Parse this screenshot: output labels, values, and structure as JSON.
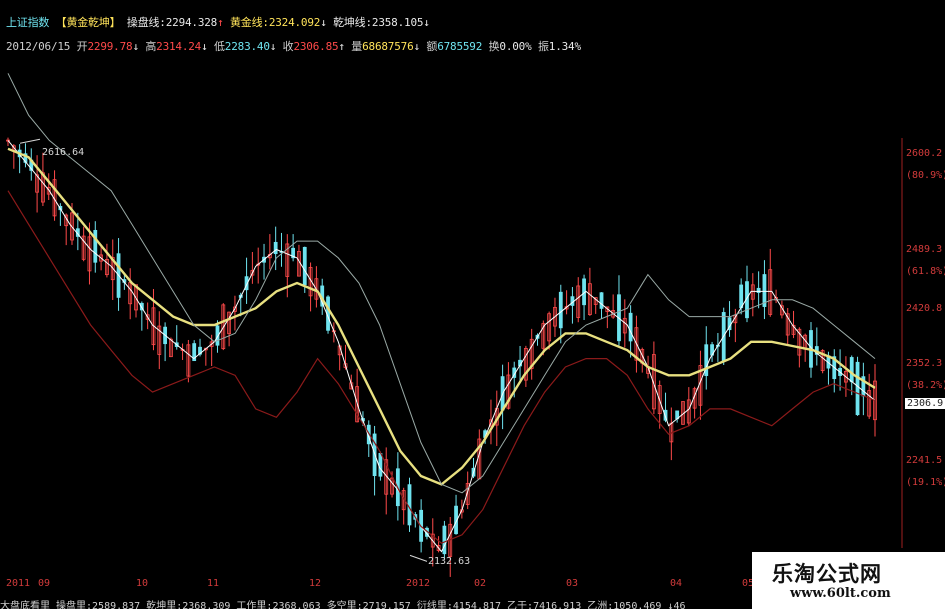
{
  "header": {
    "line1": {
      "index_name": "上证指数",
      "indicator": "【黄金乾坤】",
      "caopan_label": "操盘线:",
      "caopan_value": "2294.328",
      "caopan_arrow": "↑",
      "huangjin_label": "黄金线:",
      "huangjin_value": "2324.092",
      "huangjin_arrow": "↓",
      "qiankun_label": "乾坤线:",
      "qiankun_value": "2358.105",
      "qiankun_arrow": "↓"
    },
    "line2": {
      "date": "2012/06/15",
      "open_label": "开",
      "open_value": "2299.78",
      "open_arrow": "↓",
      "high_label": "高",
      "high_value": "2314.24",
      "high_arrow": "↓",
      "low_label": "低",
      "low_value": "2283.40",
      "low_arrow": "↓",
      "close_label": "收",
      "close_value": "2306.85",
      "close_arrow": "↑",
      "volume_label": "量",
      "volume_value": "68687576",
      "volume_arrow": "↓",
      "amount_label": "额",
      "amount_value": "6785592",
      "turnover_label": "换",
      "turnover_value": "0.00%",
      "amplitude_label": "振",
      "amplitude_value": "1.34%"
    }
  },
  "y_axis": [
    {
      "price": "2600.2",
      "pct": "(80.9%)"
    },
    {
      "price": "2489.3",
      "pct": "(61.8%)"
    },
    {
      "price": "2420.8",
      "pct": ""
    },
    {
      "price": "2352.3",
      "pct": "(38.2%)"
    },
    {
      "price": "2241.5",
      "pct": "(19.1%)"
    }
  ],
  "current_price": "2306.9",
  "annotations": {
    "high_mark": "2616.64",
    "low_mark": "2132.63"
  },
  "x_axis": [
    "2011",
    "09",
    "10",
    "11",
    "12",
    "2012",
    "02",
    "03",
    "04",
    "05"
  ],
  "bottom_bar": "大盘底看里  操盘里:2589.837  乾坤里:2368.309  工作里:2368.063  多空里:2719.157  衍线里:4154.817  乙于:7416.913  乙洲:1050.469  ↓46",
  "watermark": {
    "title": "乐淘公式网",
    "url": "www.60lt.com"
  },
  "colors": {
    "up": "#ff4a4a",
    "down": "#6fe3ef",
    "huangjin": "#e8e080",
    "caopan": "#ffffff",
    "qiankun": "#9aaaa6",
    "lower": "#8b1a1a"
  },
  "chart_data": {
    "type": "line",
    "title": "",
    "xlabel": "",
    "ylabel": "",
    "ylim": [
      2100,
      2650
    ],
    "x_ticks": [
      "2011",
      "09",
      "10",
      "11",
      "12",
      "2012",
      "02",
      "03",
      "04",
      "05"
    ],
    "series": [
      {
        "name": "操盘线",
        "values": [
          2620,
          2590,
          2560,
          2520,
          2490,
          2470,
          2440,
          2400,
          2380,
          2360,
          2380,
          2420,
          2470,
          2490,
          2480,
          2440,
          2380,
          2300,
          2230,
          2200,
          2160,
          2130,
          2180,
          2260,
          2320,
          2360,
          2400,
          2420,
          2440,
          2420,
          2400,
          2350,
          2280,
          2300,
          2360,
          2400,
          2440,
          2440,
          2400,
          2370,
          2350,
          2330,
          2310
        ]
      },
      {
        "name": "黄金线",
        "values": [
          2610,
          2600,
          2570,
          2540,
          2510,
          2480,
          2450,
          2430,
          2410,
          2400,
          2400,
          2410,
          2420,
          2440,
          2450,
          2440,
          2400,
          2350,
          2300,
          2250,
          2220,
          2210,
          2230,
          2260,
          2300,
          2340,
          2370,
          2390,
          2390,
          2380,
          2370,
          2350,
          2340,
          2340,
          2350,
          2360,
          2380,
          2380,
          2375,
          2370,
          2360,
          2340,
          2325
        ]
      },
      {
        "name": "乾坤线",
        "values": [
          2700,
          2650,
          2620,
          2600,
          2580,
          2560,
          2520,
          2480,
          2440,
          2400,
          2380,
          2390,
          2430,
          2480,
          2500,
          2500,
          2480,
          2450,
          2400,
          2330,
          2260,
          2210,
          2200,
          2220,
          2260,
          2300,
          2340,
          2380,
          2400,
          2410,
          2420,
          2460,
          2430,
          2410,
          2410,
          2410,
          2420,
          2430,
          2430,
          2420,
          2400,
          2380,
          2360
        ]
      },
      {
        "name": "",
        "values": [
          2560,
          2520,
          2480,
          2440,
          2400,
          2370,
          2340,
          2320,
          2330,
          2340,
          2350,
          2340,
          2300,
          2290,
          2320,
          2360,
          2330,
          2290,
          2250,
          2200,
          2160,
          2140,
          2150,
          2180,
          2230,
          2280,
          2320,
          2350,
          2360,
          2360,
          2340,
          2300,
          2270,
          2280,
          2300,
          2300,
          2290,
          2280,
          2300,
          2320,
          2330,
          2320,
          2310
        ]
      }
    ],
    "candles": {
      "high": 2616.64,
      "low": 2132.63,
      "last_close": 2306.85
    }
  }
}
